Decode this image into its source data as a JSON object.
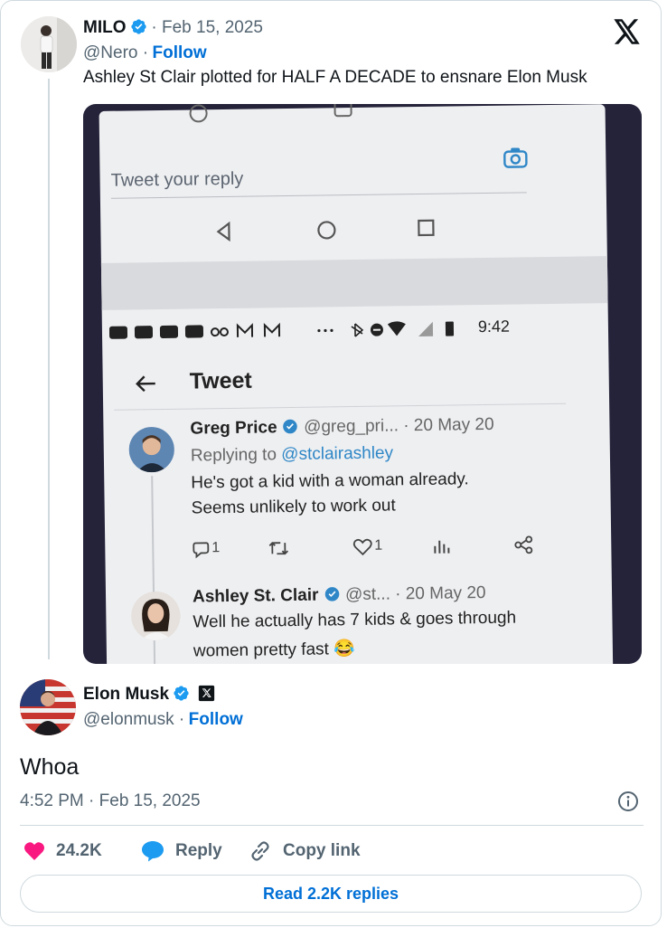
{
  "quoted_tweet": {
    "author_name": "MILO",
    "date": "· Feb 15, 2025",
    "handle": "@Nero ·",
    "follow_label": "Follow",
    "text": "Ashley St Clair plotted for HALF A DECADE to ensnare Elon Musk"
  },
  "photo": {
    "reply_placeholder": "Tweet your reply",
    "status_time": "9:42",
    "header_title": "Tweet",
    "tweets": [
      {
        "name": "Greg Price",
        "handle": "@greg_pri...",
        "date": "· 20 May 20",
        "replying_to_prefix": "Replying to",
        "replying_to": "@stclairashley",
        "line1": "He's got a kid with a woman already.",
        "line2": "Seems unlikely to work out",
        "reply_count": "1",
        "like_count": "1"
      },
      {
        "name": "Ashley St. Clair",
        "handle": "@st...",
        "date": "· 20 May 20",
        "line1": "Well he actually has 7 kids & goes through",
        "line2": "women pretty fast 😂"
      }
    ]
  },
  "main_tweet": {
    "author_name": "Elon Musk",
    "handle": "@elonmusk ·",
    "follow_label": "Follow",
    "text": "Whoa",
    "timestamp": "4:52 PM · Feb 15, 2025"
  },
  "actions": {
    "likes": "24.2K",
    "reply_label": "Reply",
    "copy_link_label": "Copy link",
    "read_replies_label": "Read 2.2K replies"
  },
  "colors": {
    "link_blue": "#006fd6",
    "verified_blue": "#1d9bf0",
    "like_pink": "#f91880",
    "border": "#cfd9de"
  },
  "icons": [
    "x-logo-icon",
    "verified-badge-icon",
    "x-affiliate-badge-icon",
    "info-icon",
    "heart-icon",
    "reply-bubble-icon",
    "link-icon"
  ]
}
